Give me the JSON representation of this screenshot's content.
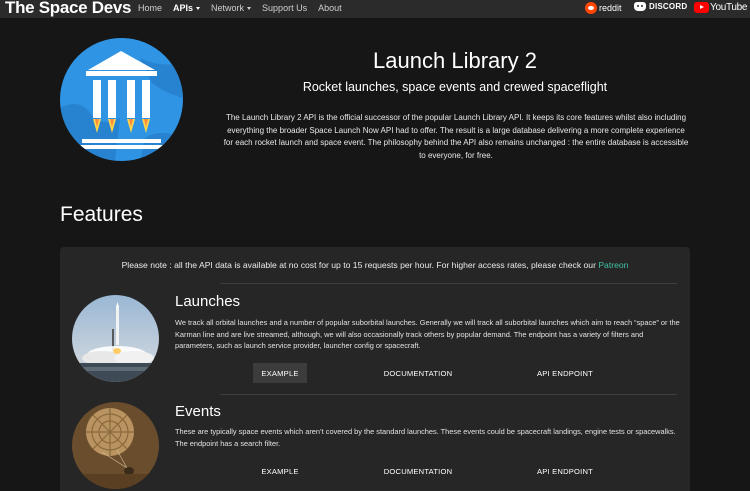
{
  "navbar": {
    "brand": "The Space Devs",
    "links": [
      {
        "label": "Home",
        "active": false,
        "dropdown": false
      },
      {
        "label": "APIs",
        "active": true,
        "dropdown": true
      },
      {
        "label": "Network",
        "active": false,
        "dropdown": true
      },
      {
        "label": "Support Us",
        "active": false,
        "dropdown": false
      },
      {
        "label": "About",
        "active": false,
        "dropdown": false
      }
    ],
    "social": {
      "reddit": "reddit",
      "discord": "DISCORD",
      "youtube": "YouTube"
    }
  },
  "hero": {
    "title": "Launch Library 2",
    "subtitle": "Rocket launches, space events and crewed spaceflight",
    "description": "The Launch Library 2 API is the official successor of the popular Launch Library API. It keeps its core features whilst also including everything the broader Space Launch Now API had to offer. The result is a large database delivering a more complete experience for each rocket launch and space event. The philosophy behind the API also remains unchanged : the entire database is accessible to everyone, for free."
  },
  "features": {
    "heading": "Features",
    "notice_text": "Please note : all the API data is available at no cost for up to 15 requests per hour. For higher access rates, please check our ",
    "notice_link": "Patreon",
    "items": [
      {
        "title": "Launches",
        "description": "We track all orbital launches and a number of popular suborbital launches. Generally we will track all suborbital launches which aim to reach “space” or the Karman line and are live streamed, although, we will also occasionally track others by popular demand. The endpoint has a variety of filters and parameters, such as launch service provider, launcher config or spacecraft.",
        "buttons": [
          "EXAMPLE",
          "DOCUMENTATION",
          "API ENDPOINT"
        ]
      },
      {
        "title": "Events",
        "description": "These are typically space events which aren’t covered by the standard launches. These events could be spacecraft landings, engine tests or spacewalks. The endpoint has a search filter.",
        "buttons": [
          "EXAMPLE",
          "DOCUMENTATION",
          "API ENDPOINT"
        ]
      }
    ]
  },
  "colors": {
    "background": "#161616",
    "navbar": "#2b2b2b",
    "card": "#262626",
    "link_accent": "#3fc1a6",
    "logo_blue": "#2f94e4",
    "reddit": "#ff4500",
    "youtube": "#ff0000"
  },
  "icons": {
    "logo": "government-building-rockets-logo",
    "reddit": "reddit-alien-icon",
    "discord": "discord-icon",
    "youtube": "youtube-play-icon"
  }
}
